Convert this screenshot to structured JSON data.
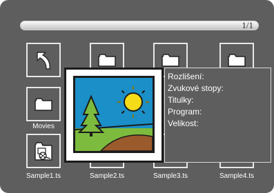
{
  "browser": {
    "page_indicator": "1/1",
    "progress_fraction": 1.0
  },
  "tiles": [
    {
      "id": "back",
      "label": "",
      "icon": "back-arrow-icon"
    },
    {
      "id": "folder-top-2",
      "label": "",
      "icon": "folder-icon"
    },
    {
      "id": "folder-top-3",
      "label": "",
      "icon": "folder-icon"
    },
    {
      "id": "folder-top-4",
      "label": "",
      "icon": "folder-icon"
    },
    {
      "id": "movies",
      "label": "Movies",
      "icon": "folder-icon"
    },
    {
      "id": "sample1",
      "label": "Sample1.ts",
      "icon": "video-file-icon"
    },
    {
      "id": "sample2",
      "label": "Sample2.ts",
      "icon": "video-file-icon"
    },
    {
      "id": "sample3",
      "label": "Sample3.ts",
      "icon": "video-file-icon"
    },
    {
      "id": "sample4",
      "label": "Sample4.ts",
      "icon": "video-file-icon"
    }
  ],
  "info": {
    "resolution_label": "Rozlišení:",
    "audio_tracks_label": "Zvukové stopy:",
    "subtitles_label": "Titulky:",
    "program_label": "Program:",
    "size_label": "Velikost:"
  },
  "colors": {
    "background": "#5e5e5e",
    "tile_border": "#e8e8e8",
    "text": "#ffffff",
    "preview_sky": "#1b8fc7",
    "preview_grass": "#7dbb3e",
    "preview_hill": "#9b5a2b",
    "preview_sun": "#f5dc18"
  }
}
